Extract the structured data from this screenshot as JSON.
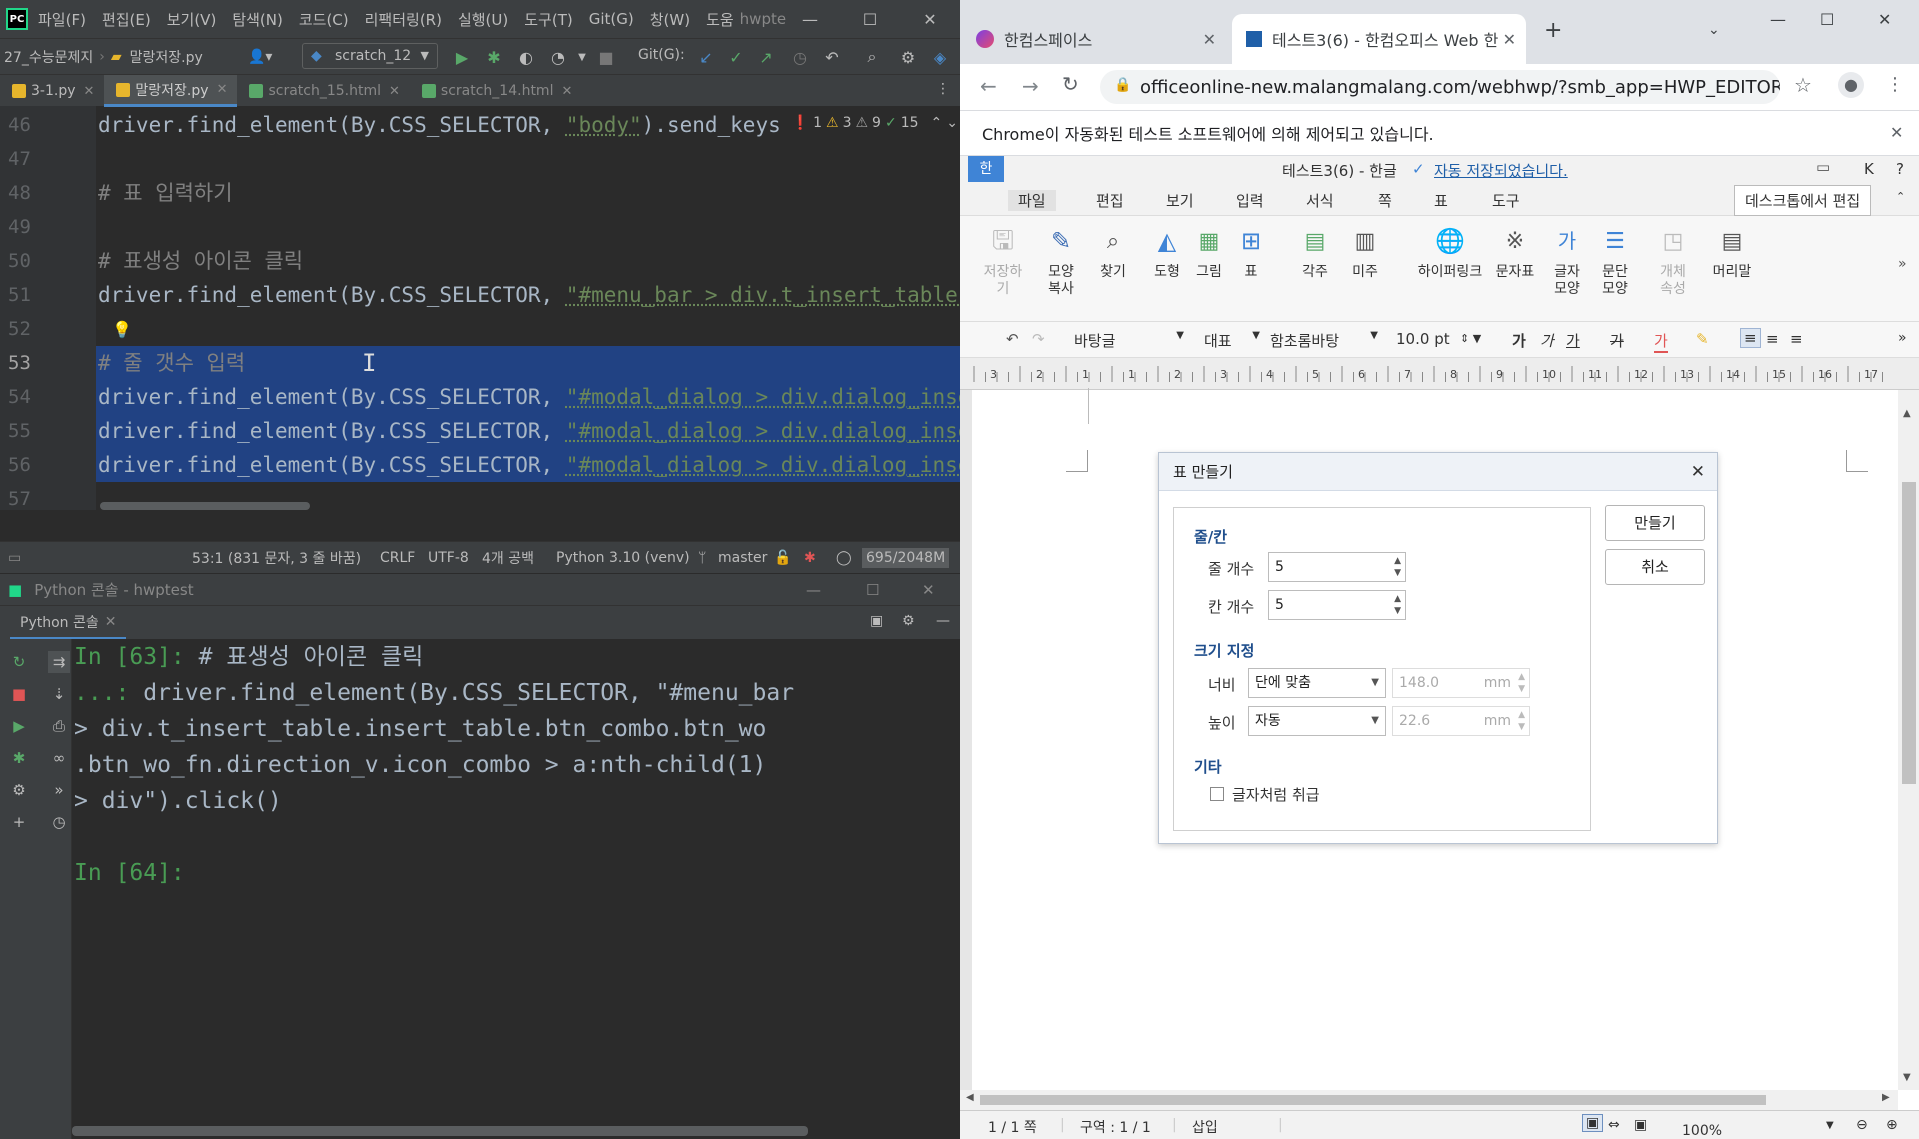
{
  "ide": {
    "menu": [
      "파일(F)",
      "편집(E)",
      "보기(V)",
      "탐색(N)",
      "코드(C)",
      "리팩터링(R)",
      "실행(U)",
      "도구(T)",
      "Git(G)",
      "창(W)",
      "도움",
      "hwpte"
    ],
    "breadcrumb": [
      "27_수능문제지",
      "말랑저장.py"
    ],
    "run_config": "scratch_12",
    "git_label": "Git(G):",
    "tabs": [
      {
        "label": "3-1.py",
        "active": false
      },
      {
        "label": "말랑저장.py",
        "active": true
      },
      {
        "label": "scratch_15.html",
        "active": false
      },
      {
        "label": "scratch_14.html",
        "active": false
      }
    ],
    "line_numbers": [
      "46",
      "47",
      "48",
      "49",
      "50",
      "51",
      "52",
      "53",
      "54",
      "55",
      "56",
      "57"
    ],
    "code_lines": [
      {
        "pre": "driver.find_element(By.CSS_SELECTOR, ",
        "str": "\"body\"",
        "post": ").send_keys"
      },
      {
        "comment": ""
      },
      {
        "comment": "# 표 입력하기"
      },
      {
        "comment": ""
      },
      {
        "comment": "# 표생성 아이콘 클릭"
      },
      {
        "pre": "driver.find_element(By.CSS_SELECTOR, ",
        "str": "\"#menu_bar > div.t_insert_table.ins",
        "post": ""
      },
      {
        "comment": ""
      },
      {
        "comment": "# 줄 갯수 입력"
      },
      {
        "pre": "driver.find_element(By.CSS_SELECTOR, ",
        "str": "\"#modal_dialog > div.dialog_insert_",
        "post": ""
      },
      {
        "pre": "driver.find_element(By.CSS_SELECTOR, ",
        "str": "\"#modal_dialog > div.dialog_insert_",
        "post": ""
      },
      {
        "pre": "driver.find_element(By.CSS_SELECTOR, ",
        "str": "\"#modal_dialog > div.dialog_insert_",
        "post": ""
      },
      {
        "comment": ""
      }
    ],
    "inspections": {
      "errors": "1",
      "warnings": "3",
      "weak_warnings": "9",
      "typos": "15"
    },
    "status": {
      "position": "53:1 (831 문자, 3 줄 바꿈)",
      "line_sep": "CRLF",
      "encoding": "UTF-8",
      "indent": "4개 공백",
      "interpreter": "Python 3.10 (venv)",
      "branch": "master",
      "memory": "695/2048M"
    },
    "console_title": "Python 콘솔 - hwptest",
    "console_tab": "Python 콘솔",
    "console_lines": [
      {
        "prompt": "In [63]:",
        "text": " # 표생성 아이콘 클릭"
      },
      {
        "prompt": "   ...:",
        "text": " driver.find_element(By.CSS_SELECTOR, \"#menu_bar"
      },
      {
        "prompt": "",
        "text": "     > div.t_insert_table.insert_table.btn_combo.btn_wo"
      },
      {
        "prompt": "",
        "text": "   .btn_wo_fn.direction_v.icon_combo > a:nth-child(1)"
      },
      {
        "prompt": "",
        "text": "    > div\").click()"
      },
      {
        "prompt": "",
        "text": ""
      },
      {
        "prompt": "In [64]:",
        "text": ""
      }
    ]
  },
  "browser": {
    "tabs": [
      {
        "label": "한컴스페이스",
        "active": false
      },
      {
        "label": "테스트3(6) - 한컴오피스 Web 한",
        "active": true
      }
    ],
    "url": "officeonline-new.malangmalang.com/webhwp/?smb_app=HWP_EDITOR&docId...",
    "info_bar": "Chrome이 자동화된 테스트 소프트웨어에 의해 제어되고 있습니다."
  },
  "hwp": {
    "logo": "한",
    "doc_title": "테스트3(6) - 한글",
    "autosave": "자동 저장되었습니다.",
    "title_right": [
      "K",
      "?"
    ],
    "menu": [
      "파일",
      "편집",
      "보기",
      "입력",
      "서식",
      "쪽",
      "표",
      "도구"
    ],
    "desktop_edit": "데스크톱에서 편집",
    "ribbon": [
      {
        "label": "저장하기",
        "disabled": true
      },
      {
        "label": "모양\n복사",
        "disabled": false
      },
      {
        "label": "찾기",
        "disabled": false
      },
      {
        "label": "도형",
        "disabled": false
      },
      {
        "label": "그림",
        "disabled": false
      },
      {
        "label": "표",
        "disabled": false
      },
      {
        "label": "각주",
        "disabled": false
      },
      {
        "label": "미주",
        "disabled": false
      },
      {
        "label": "하이퍼링크",
        "disabled": false
      },
      {
        "label": "문자표",
        "disabled": false
      },
      {
        "label": "글자\n모양",
        "disabled": false
      },
      {
        "label": "문단\n모양",
        "disabled": false
      },
      {
        "label": "개체\n속성",
        "disabled": true
      },
      {
        "label": "머리말",
        "disabled": false
      }
    ],
    "format": {
      "style": "바탕글",
      "font_class": "대표",
      "font": "함초롬바탕",
      "size": "10.0",
      "size_unit": "pt",
      "bold": "가",
      "italic": "가",
      "underline": "가",
      "strike": "가",
      "color": "가"
    },
    "ruler_nums": [
      "3",
      "2",
      "1",
      "1",
      "2",
      "3",
      "4",
      "5",
      "6",
      "7",
      "8",
      "9",
      "10",
      "11",
      "12",
      "13",
      "14",
      "15",
      "16",
      "17"
    ],
    "status": {
      "page": "1 / 1 쪽",
      "section": "구역 : 1 / 1",
      "mode": "삽입",
      "zoom": "100%"
    },
    "dialog": {
      "title": "표 만들기",
      "section_rowcol": "줄/칸",
      "rows_label": "줄 개수",
      "rows_value": "5",
      "cols_label": "칸 개수",
      "cols_value": "5",
      "section_size": "크기 지정",
      "width_label": "너비",
      "width_mode": "단에 맞춤",
      "width_value": "148.0",
      "width_unit": "mm",
      "height_label": "높이",
      "height_mode": "자동",
      "height_value": "22.6",
      "height_unit": "mm",
      "section_etc": "기타",
      "treat_as_char": "글자처럼 취급",
      "create_button": "만들기",
      "cancel_button": "취소"
    }
  }
}
